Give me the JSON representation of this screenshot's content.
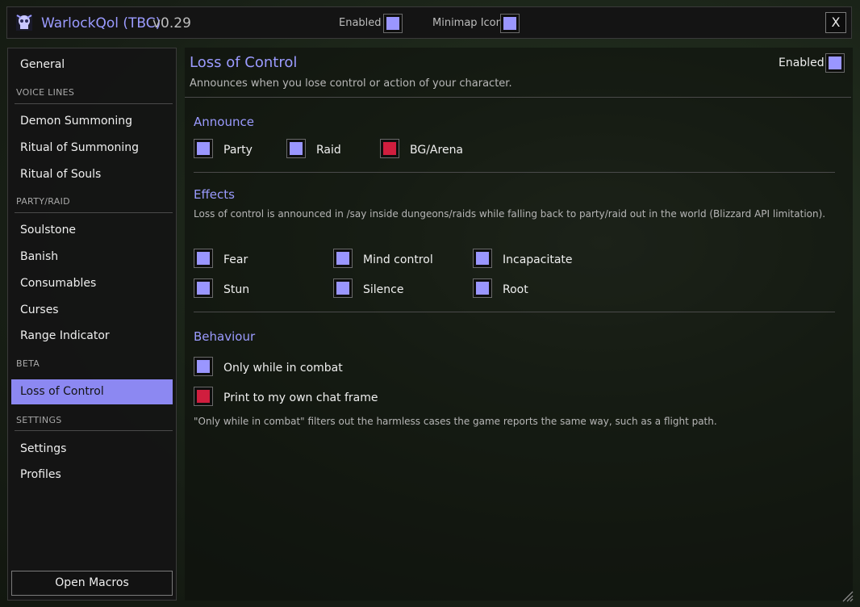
{
  "header": {
    "title": "WarlockQol (TBC)",
    "version": "v0.29",
    "enabled_label": "Enabled",
    "minimap_label": "Minimap Icon",
    "close_label": "X"
  },
  "sidebar": {
    "general": "General",
    "sections": {
      "voice_lines": "VOICE LINES",
      "party_raid": "PARTY/RAID",
      "beta": "BETA",
      "settings": "SETTINGS"
    },
    "voice_items": [
      "Demon Summoning",
      "Ritual of Summoning",
      "Ritual of Souls"
    ],
    "party_items": [
      "Soulstone",
      "Banish",
      "Consumables",
      "Curses",
      "Range Indicator"
    ],
    "beta_items": [
      "Loss of Control"
    ],
    "settings_items": [
      "Settings",
      "Profiles"
    ],
    "open_macros": "Open Macros"
  },
  "main": {
    "title": "Loss of Control",
    "description": "Announces when you lose control or action of your character.",
    "enabled_label": "Enabled",
    "announce": {
      "title": "Announce",
      "options": [
        "Party",
        "Raid",
        "BG/Arena"
      ]
    },
    "effects": {
      "title": "Effects",
      "note": "Loss of control is announced in /say inside dungeons/raids while falling back to party/raid out in the world (Blizzard API limitation).",
      "options": [
        "Fear",
        "Mind control",
        "Incapacitate",
        "Stun",
        "Silence",
        "Root"
      ]
    },
    "behaviour": {
      "title": "Behaviour",
      "options": [
        "Only while in combat",
        "Print to my own chat frame"
      ],
      "note": "\"Only while in combat\" filters out the harmless cases the game reports the same way, such as a flight path."
    }
  },
  "colors": {
    "accent": "#9b9bff",
    "checked": "#9a96ff",
    "unchecked": "#d01e3e",
    "active_nav": "#8c88f2"
  }
}
